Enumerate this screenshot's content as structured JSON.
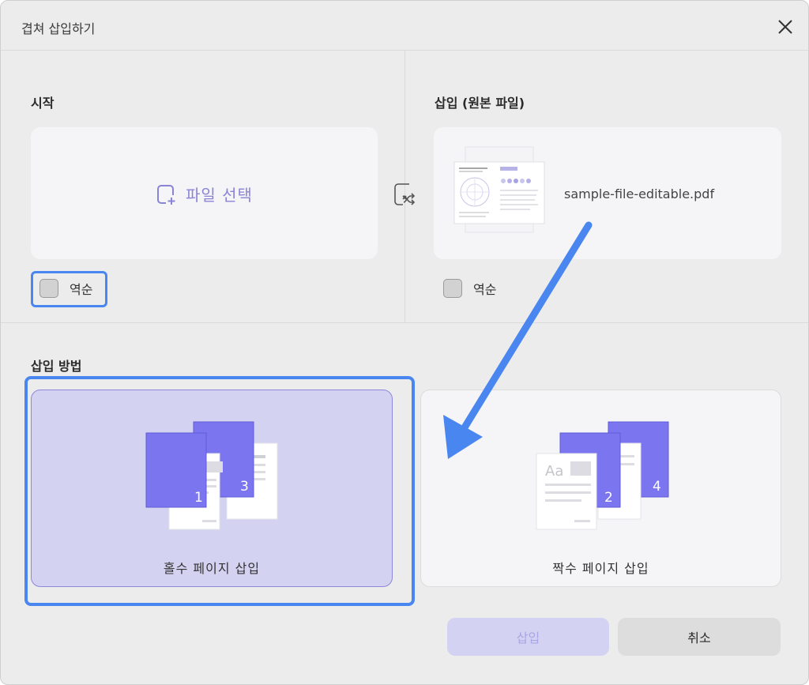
{
  "dialog": {
    "title": "겹쳐 삽입하기",
    "close_icon": "close-icon"
  },
  "start": {
    "heading": "시작",
    "file_select_label": "파일 선택",
    "reverse_label": "역순"
  },
  "insert": {
    "heading": "삽입 (원본 파일)",
    "file_name": "sample-file-editable.pdf",
    "reverse_label": "역순"
  },
  "method": {
    "heading": "삽입 방법",
    "odd": {
      "label": "홀수 페이지 삽입",
      "page_a": "1",
      "page_b": "3"
    },
    "even": {
      "label": "짝수 페이지 삽입",
      "page_a": "2",
      "page_b": "4",
      "thumb_text": "Aa"
    }
  },
  "buttons": {
    "insert_label": "삽입",
    "cancel_label": "취소"
  },
  "colors": {
    "accent": "#7b76f0",
    "focus": "#4a86f0",
    "selected_card": "#d3d3f1"
  }
}
